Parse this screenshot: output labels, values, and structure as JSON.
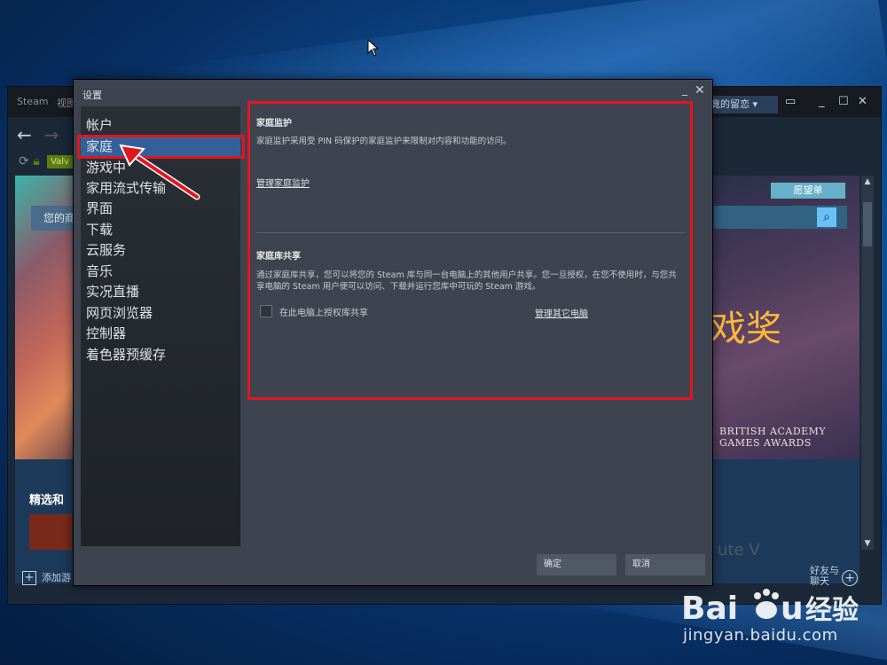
{
  "steam_window": {
    "brand": "Steam",
    "menu_view": "视图",
    "notification": "竟的留恋 ▾",
    "valve_badge": "Valv",
    "your_store": "您的商",
    "featured_title": "精选和",
    "wishlist_label": "愿望单",
    "award_big": "戏奖",
    "award_line1": "BRITISH ACADEMY",
    "award_line2": "GAMES AWARDS",
    "ghost_text": "ute V",
    "add_game": "添加游",
    "friends_line1": "好友与",
    "friends_line2": "聊天"
  },
  "settings": {
    "title": "设置",
    "categories": [
      "帐户",
      "家庭",
      "游戏中",
      "家用流式传输",
      "界面",
      "下载",
      "云服务",
      "音乐",
      "实况直播",
      "网页浏览器",
      "控制器",
      "着色器预缓存"
    ],
    "selected_index": 1,
    "family_view": {
      "title": "家庭监护",
      "desc": "家庭监护采用受 PIN 码保护的家庭监护来限制对内容和功能的访问。",
      "link": "管理家庭监护"
    },
    "library_sharing": {
      "title": "家庭库共享",
      "desc": "通过家庭库共享，您可以将您的 Steam 库与同一台电脑上的其他用户共享。您一旦授权，在您不使用时，与您共享电脑的 Steam 用户便可以访问、下载并运行您库中可玩的 Steam 游戏。",
      "checkbox_label": "在此电脑上授权库共享",
      "checkbox_checked": false,
      "manage_link": "管理其它电脑"
    },
    "ok_label": "确定",
    "cancel_label": "取消"
  },
  "watermark": {
    "url": "jingyan.baidu.com",
    "logo_text": "Baidu经验"
  },
  "colors": {
    "annotation_red": "#e4141e",
    "selected_blue": "#34609a",
    "dialog_bg": "#3d4450"
  }
}
